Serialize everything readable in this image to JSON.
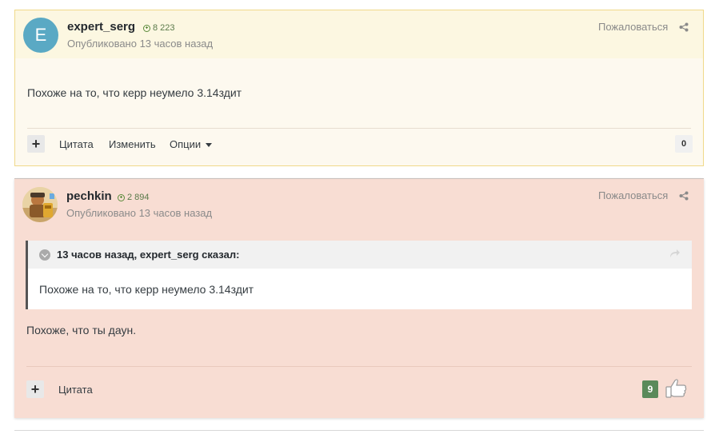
{
  "posts": [
    {
      "avatar_letter": "E",
      "author": "expert_serg",
      "reputation": "8 223",
      "published": "Опубликовано 13 часов назад",
      "report": "Пожаловаться",
      "body": "Похоже на то,  что керр неумело 3.14здит",
      "actions": {
        "plus": "+",
        "quote": "Цитата",
        "edit": "Изменить",
        "options": "Опции"
      },
      "likes": "0"
    },
    {
      "author": "pechkin",
      "reputation": "2 894",
      "published": "Опубликовано 13 часов назад",
      "report": "Пожаловаться",
      "quote": {
        "citation": "13 часов назад, expert_serg сказал:",
        "text": "Похоже на то,  что керр неумело 3.14здит"
      },
      "body": "Похоже, что ты даун.",
      "actions": {
        "plus": "+",
        "quote": "Цитата"
      },
      "likes": "9"
    }
  ],
  "colors": {
    "post1_bg": "#fdf9ef",
    "post2_bg": "#f8ddd3",
    "reputation": "#5a8a3a",
    "like_badge": "#5a8a5a",
    "avatar_e": "#5aa9c4"
  }
}
